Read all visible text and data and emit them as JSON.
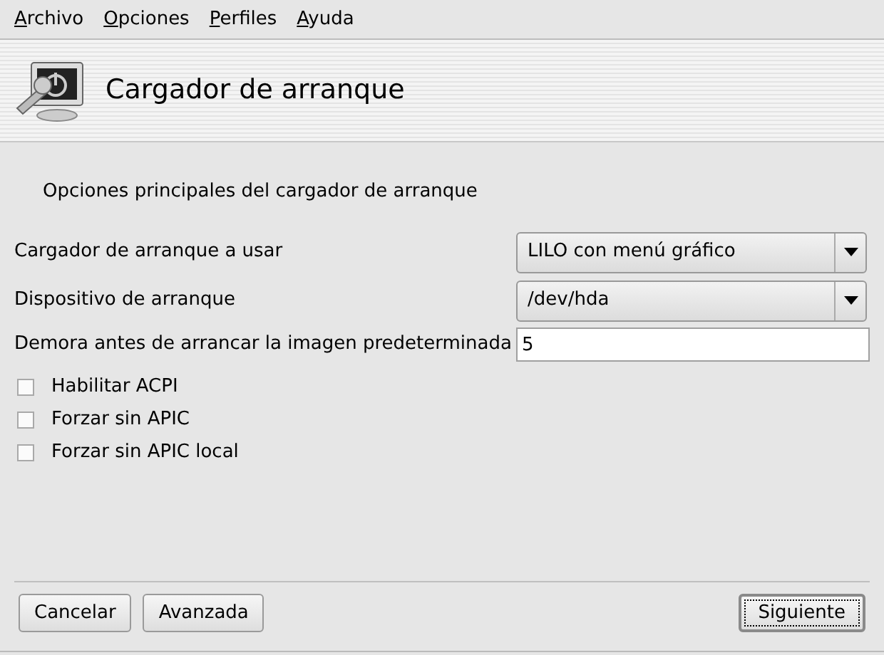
{
  "menu": [
    {
      "label": "Archivo"
    },
    {
      "label": "Opciones"
    },
    {
      "label": "Perfiles"
    },
    {
      "label": "Ayuda"
    }
  ],
  "header": {
    "title": "Cargador de arranque"
  },
  "subtitle": "Opciones principales del cargador de arranque",
  "fields": [
    {
      "kind": "select",
      "label": "Cargador de arranque a usar",
      "value": "LILO con menú gráfico"
    },
    {
      "kind": "select",
      "label": "Dispositivo de arranque",
      "value": "/dev/hda"
    },
    {
      "kind": "text",
      "label": "Demora antes de arrancar la imagen predeterminada",
      "value": "5"
    }
  ],
  "options": [
    {
      "label": "Habilitar ACPI",
      "checked": false
    },
    {
      "label": "Forzar sin APIC",
      "checked": false
    },
    {
      "label": "Forzar sin APIC local",
      "checked": false
    }
  ],
  "buttons": [
    {
      "label": "Cancelar",
      "default": false
    },
    {
      "label": "Avanzada",
      "default": false
    },
    {
      "label": "Siguiente",
      "default": true
    }
  ]
}
